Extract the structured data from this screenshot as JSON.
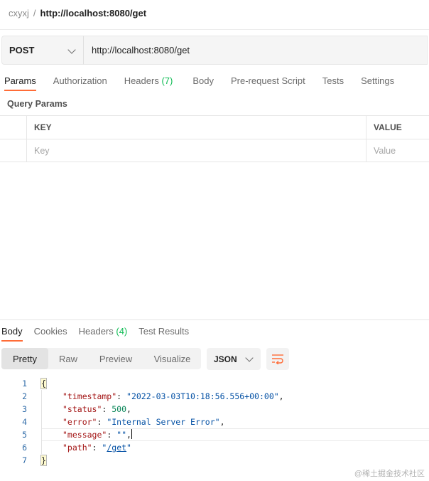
{
  "breadcrumb": {
    "workspace": "cxyxj",
    "separator": "/",
    "request": "http://localhost:8080/get"
  },
  "request": {
    "method": "POST",
    "url": "http://localhost:8080/get"
  },
  "request_tabs": [
    {
      "label": "Params",
      "active": true
    },
    {
      "label": "Authorization"
    },
    {
      "label": "Headers",
      "count": "(7)"
    },
    {
      "label": "Body"
    },
    {
      "label": "Pre-request Script"
    },
    {
      "label": "Tests"
    },
    {
      "label": "Settings"
    }
  ],
  "query_params": {
    "title": "Query Params",
    "key_header": "KEY",
    "value_header": "VALUE",
    "key_placeholder": "Key",
    "value_placeholder": "Value"
  },
  "response_tabs": [
    {
      "label": "Body",
      "active": true
    },
    {
      "label": "Cookies"
    },
    {
      "label": "Headers",
      "count": "(4)"
    },
    {
      "label": "Test Results"
    }
  ],
  "view_modes": [
    "Pretty",
    "Raw",
    "Preview",
    "Visualize"
  ],
  "active_view": "Pretty",
  "format": "JSON",
  "response_lines": [
    {
      "num": "1",
      "open": "{"
    },
    {
      "num": "2",
      "key": "\"timestamp\"",
      "colon": ": ",
      "value": "\"2022-03-03T10:18:56.556+00:00\"",
      "comma": ","
    },
    {
      "num": "3",
      "key": "\"status\"",
      "colon": ": ",
      "value": "500",
      "comma": ","
    },
    {
      "num": "4",
      "key": "\"error\"",
      "colon": ": ",
      "value": "\"Internal Server Error\"",
      "comma": ","
    },
    {
      "num": "5",
      "key": "\"message\"",
      "colon": ": ",
      "value": "\"\"",
      "comma": ","
    },
    {
      "num": "6",
      "key": "\"path\"",
      "colon": ": ",
      "q1": "\"",
      "link": "/get",
      "q2": "\""
    },
    {
      "num": "7",
      "close": "}"
    }
  ],
  "watermark": "@稀土掘金技术社区",
  "colors": {
    "accent": "#ff6c37",
    "count_green": "#0cbb52",
    "line_number": "#2f6ba8",
    "json_key": "#a31515",
    "json_string": "#0451a5",
    "json_number": "#098658"
  },
  "icons": {
    "method_dropdown": "chevron-down-icon",
    "format_dropdown": "chevron-down-icon",
    "wrap": "wrap-lines-icon"
  }
}
